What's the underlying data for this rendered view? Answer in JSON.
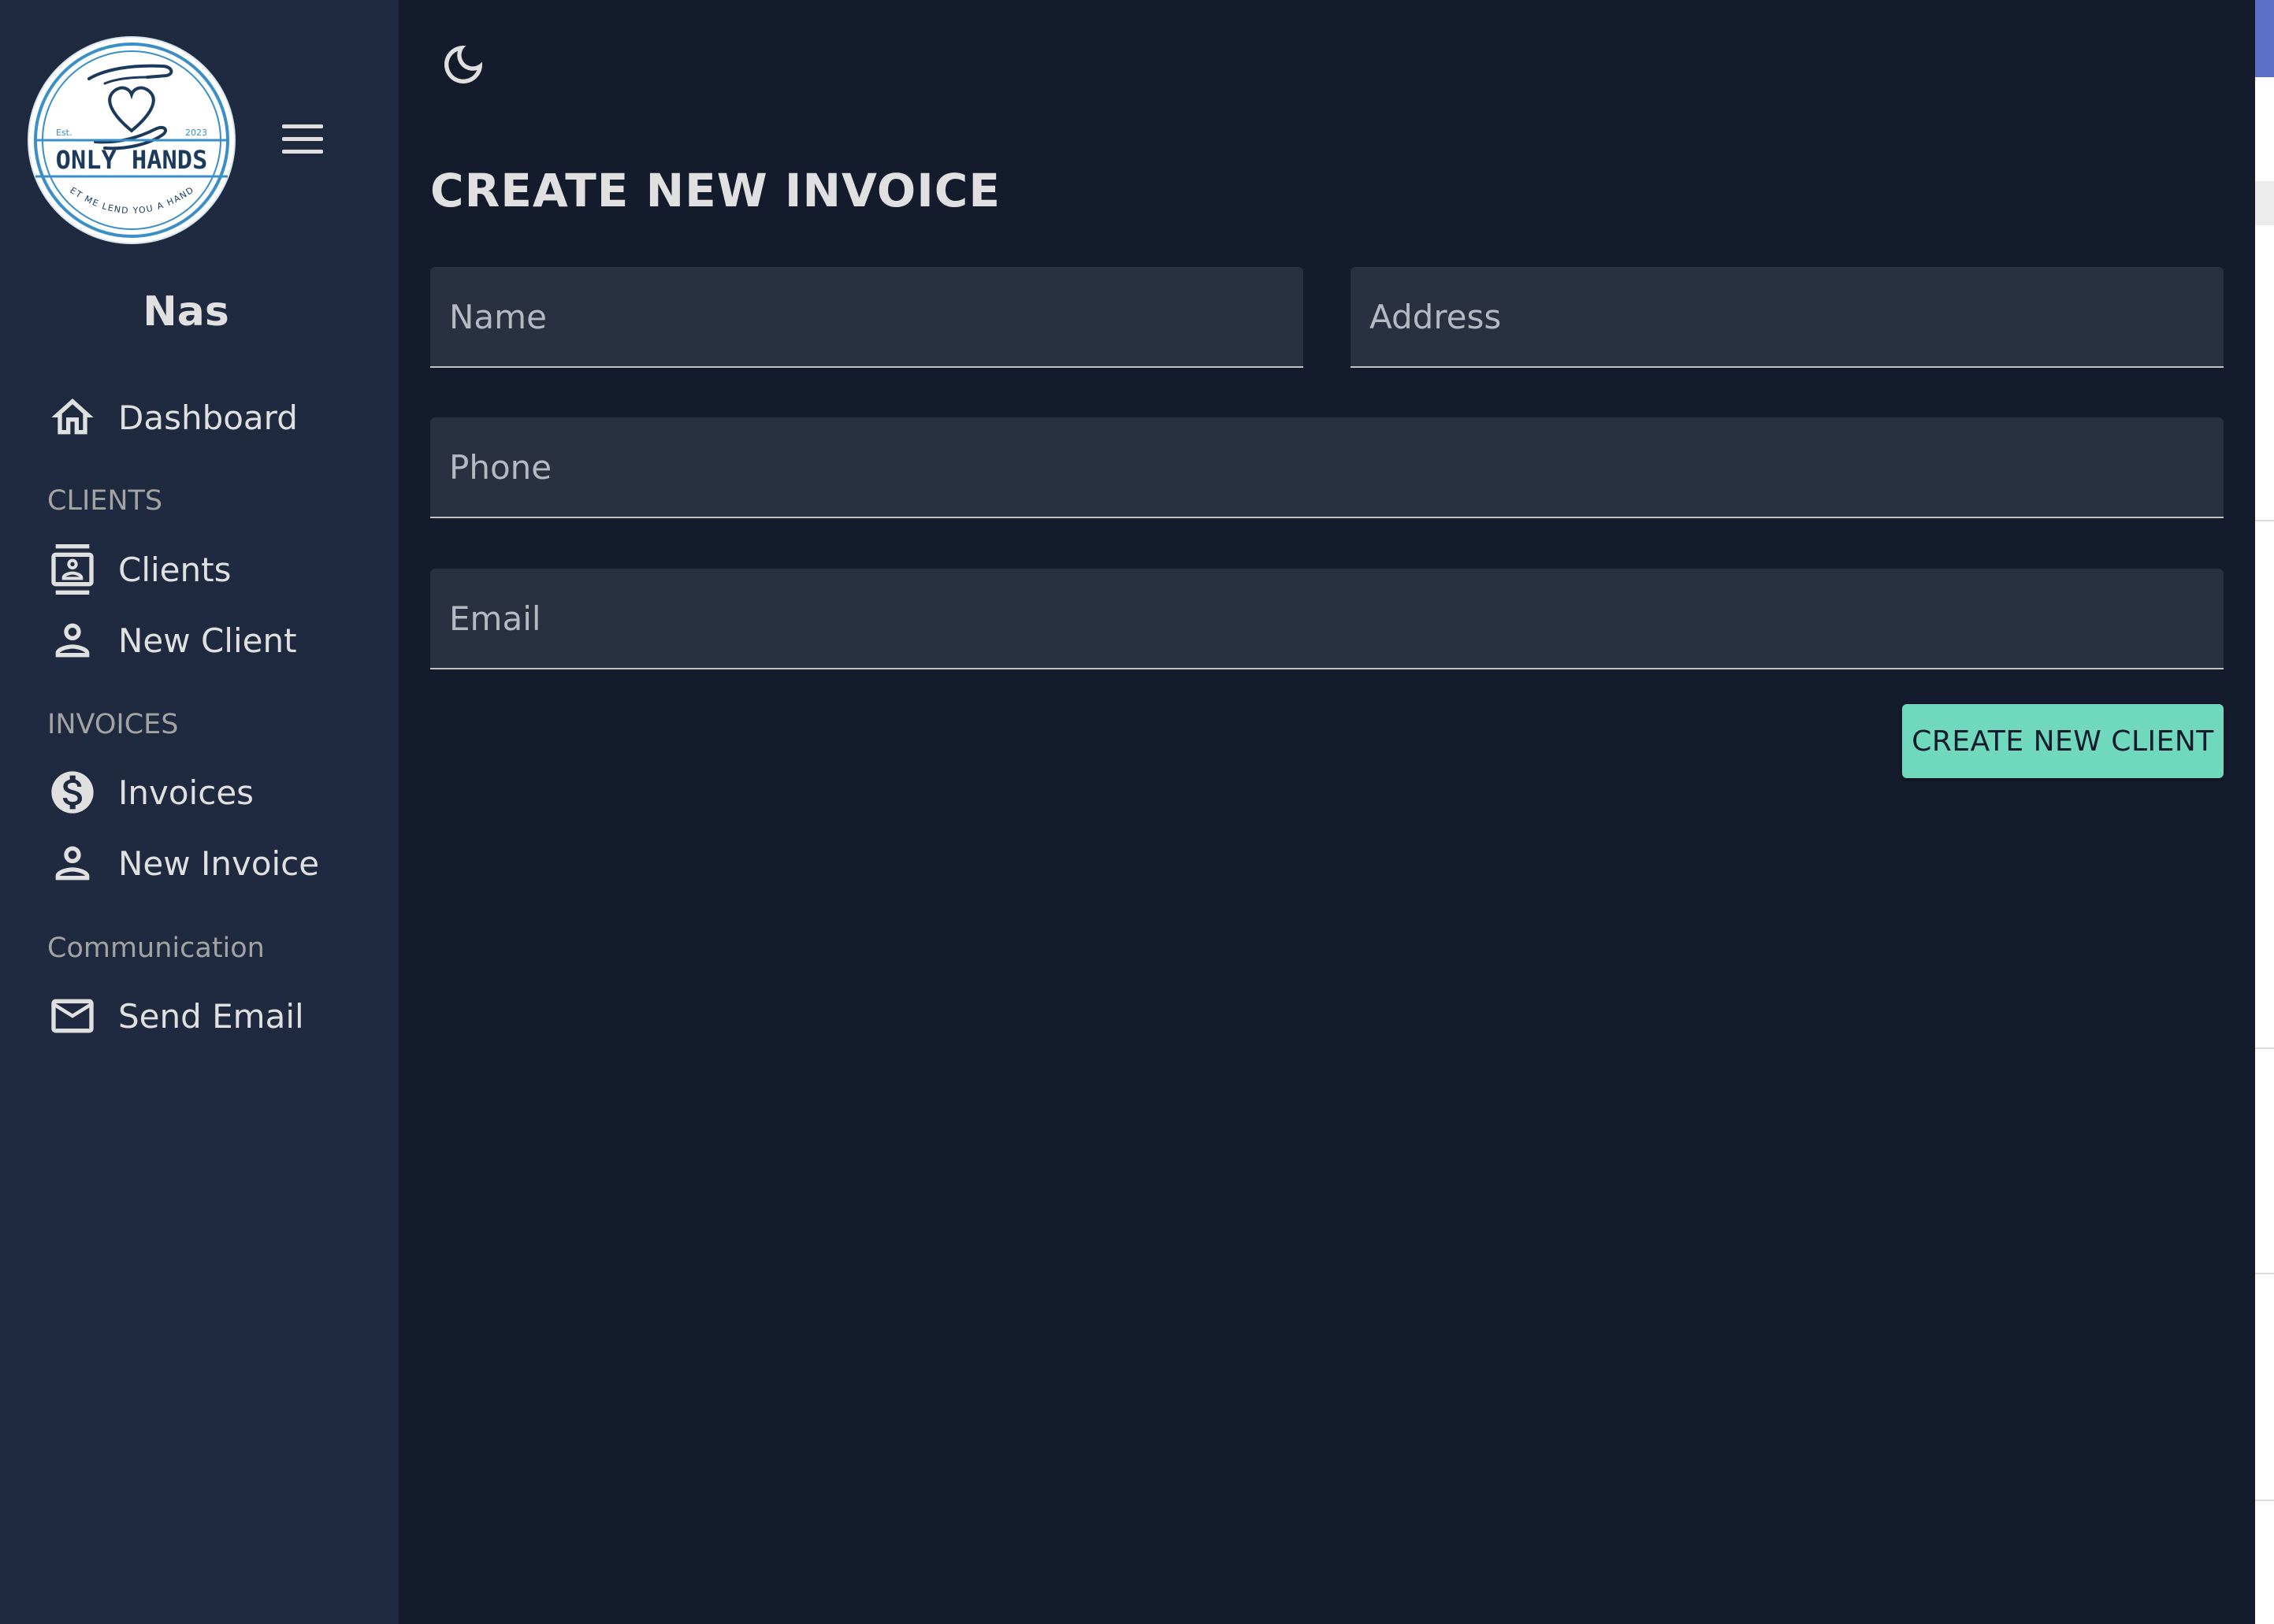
{
  "brand": {
    "logo_text": "ONLY HANDS",
    "logo_tagline": "LET ME LEND YOU A HAND!",
    "logo_est": "Est.",
    "logo_year": "2023"
  },
  "user": {
    "name": "Nas"
  },
  "sidebar": {
    "dashboard": {
      "label": "Dashboard",
      "icon": "home-icon"
    },
    "sections": {
      "clients": "CLIENTS",
      "invoices": "INVOICES",
      "communication": "Communication"
    },
    "items": {
      "clients": {
        "label": "Clients",
        "icon": "contacts-icon"
      },
      "new_client": {
        "label": "New Client",
        "icon": "person-icon"
      },
      "invoices": {
        "label": "Invoices",
        "icon": "dollar-icon"
      },
      "new_invoice": {
        "label": "New Invoice",
        "icon": "person-icon"
      },
      "send_email": {
        "label": "Send Email",
        "icon": "mail-icon"
      }
    }
  },
  "header": {
    "theme_toggle_icon": "moon-icon"
  },
  "main": {
    "title": "CREATE NEW INVOICE",
    "fields": {
      "name": {
        "placeholder": "Name",
        "value": ""
      },
      "address": {
        "placeholder": "Address",
        "value": ""
      },
      "phone": {
        "placeholder": "Phone",
        "value": ""
      },
      "email": {
        "placeholder": "Email",
        "value": ""
      }
    },
    "submit_label": "CREATE NEW CLIENT"
  },
  "colors": {
    "background": "#141b2d",
    "sidebar": "#1f2a40",
    "field": "#293040",
    "accent": "#70d8bd",
    "text": "#e0e0e0",
    "logo_blue": "#3a8fc7",
    "logo_navy": "#1b3a5c"
  }
}
